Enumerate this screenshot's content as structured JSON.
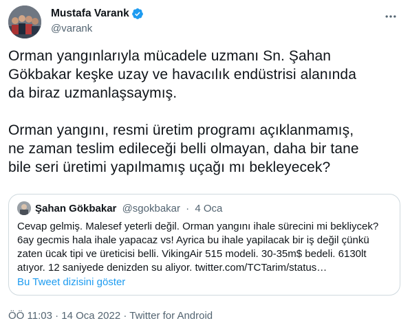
{
  "author": {
    "name": "Mustafa Varank",
    "handle": "@varank",
    "verified": true,
    "verified_color": "#1d9bf0"
  },
  "tweet": {
    "paragraph1": [
      "Orman yangınlarıyla mücadele uzmanı Sn. Şahan",
      "Gökbakar keşke uzay ve havacılık endüstrisi alanında",
      "da biraz uzmanlaşsaymış."
    ],
    "paragraph2": [
      "Orman yangını, resmi üretim programı açıklanmamış,",
      "ne zaman teslim edileceği belli olmayan, daha bir tane",
      "bile seri üretimi yapılmamış uçağı mı bekleyecek?"
    ]
  },
  "quote": {
    "name": "Şahan Gökbakar",
    "handle": "@sgokbakar",
    "separator": "·",
    "date": "4 Oca",
    "lines": [
      "Cevap gelmiş. Malesef yeterli değil. Orman yangını ihale sürecini mi bekliycek?",
      "6ay gecmis hala ihale yapacaz vs! Ayrica bu ihale yapilacak bir iş değil çünkü",
      "zaten ücak tipi ve üreticisi belli. VikingAir 515 modeli. 30-35m$ bedeli. 6130lt",
      "atıyor. 12 saniyede denizden su aliyor. twitter.com/TCTarim/status…"
    ],
    "thread_link": "Bu Tweet dizisini göster"
  },
  "footer": {
    "time": "ÖÖ 11:03",
    "separator": "·",
    "date": "14 Oca 2022",
    "app": "Twitter for Android"
  },
  "colors": {
    "text": "#0f1419",
    "secondary": "#536471",
    "link": "#1d9bf0",
    "border": "#cfd9de"
  },
  "icons": {
    "more": "more-horizontal-icon",
    "verified": "verified-badge-icon"
  }
}
